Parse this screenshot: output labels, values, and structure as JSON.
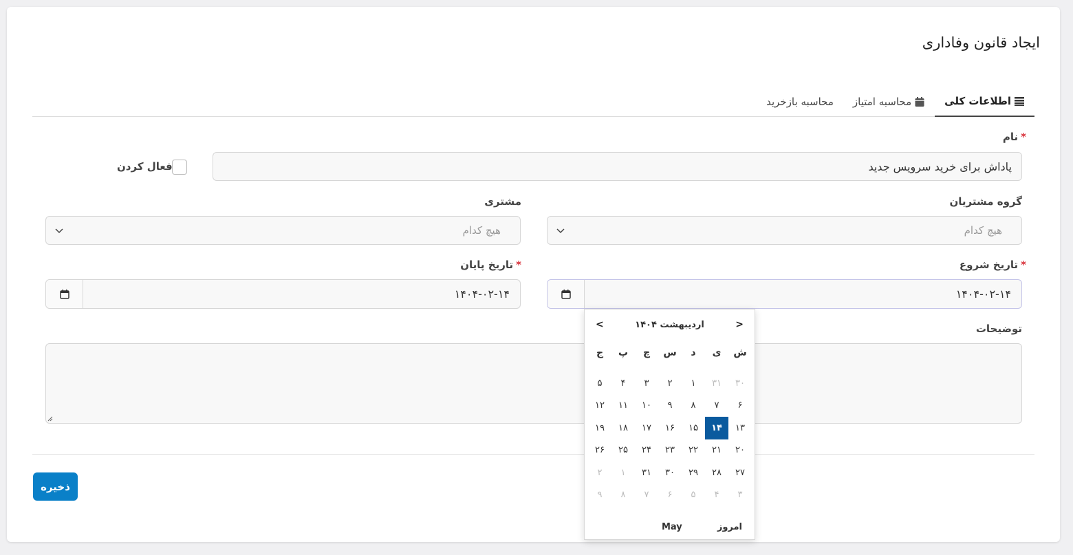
{
  "title": "ایجاد قانون وفاداری",
  "tabs": [
    {
      "label": "اطلاعات کلی",
      "icon": "list-icon",
      "active": true
    },
    {
      "label": "محاسبه امتیاز",
      "icon": "calendar-icon",
      "active": false
    },
    {
      "label": "محاسبه بازخرید",
      "icon": "",
      "active": false
    }
  ],
  "form": {
    "name_label": "نام",
    "name_value": "پاداش برای خرید سرویس جدید",
    "active_label": "فعال کردن",
    "customer_group_label": "گروه مشتریان",
    "customer_group_placeholder": "هیچ کدام",
    "customer_label": "مشتری",
    "customer_placeholder": "هیچ کدام",
    "start_date_label": "تاریخ شروع",
    "start_date_value": "۱۴۰۴-۰۲-۱۴",
    "end_date_label": "تاریخ پایان",
    "end_date_value": "۱۴۰۴-۰۲-۱۴",
    "description_label": "توضیحات",
    "required_mark": "*"
  },
  "save_label": "ذخیره",
  "calendar": {
    "month_title": "اردیبهشت ۱۴۰۴",
    "prev": "<",
    "next": ">",
    "weekdays": [
      "ش",
      "ی",
      "د",
      "س",
      "چ",
      "پ",
      "ج"
    ],
    "weeks": [
      [
        {
          "d": "۳۰",
          "o": true
        },
        {
          "d": "۳۱",
          "o": true
        },
        {
          "d": "۱"
        },
        {
          "d": "۲"
        },
        {
          "d": "۳"
        },
        {
          "d": "۴"
        },
        {
          "d": "۵"
        }
      ],
      [
        {
          "d": "۶"
        },
        {
          "d": "۷"
        },
        {
          "d": "۸"
        },
        {
          "d": "۹"
        },
        {
          "d": "۱۰"
        },
        {
          "d": "۱۱"
        },
        {
          "d": "۱۲"
        }
      ],
      [
        {
          "d": "۱۳"
        },
        {
          "d": "۱۴",
          "s": true
        },
        {
          "d": "۱۵"
        },
        {
          "d": "۱۶"
        },
        {
          "d": "۱۷"
        },
        {
          "d": "۱۸"
        },
        {
          "d": "۱۹"
        }
      ],
      [
        {
          "d": "۲۰"
        },
        {
          "d": "۲۱"
        },
        {
          "d": "۲۲"
        },
        {
          "d": "۲۳"
        },
        {
          "d": "۲۴"
        },
        {
          "d": "۲۵"
        },
        {
          "d": "۲۶"
        }
      ],
      [
        {
          "d": "۲۷"
        },
        {
          "d": "۲۸"
        },
        {
          "d": "۲۹"
        },
        {
          "d": "۳۰"
        },
        {
          "d": "۳۱"
        },
        {
          "d": "۱",
          "o": true
        },
        {
          "d": "۲",
          "o": true
        }
      ],
      [
        {
          "d": "۳",
          "o": true
        },
        {
          "d": "۴",
          "o": true
        },
        {
          "d": "۵",
          "o": true
        },
        {
          "d": "۶",
          "o": true
        },
        {
          "d": "۷",
          "o": true
        },
        {
          "d": "۸",
          "o": true
        },
        {
          "d": "۹",
          "o": true
        }
      ]
    ],
    "today_label": "امروز",
    "locale_label": "May"
  },
  "colors": {
    "accent": "#0a80c8",
    "selected_day": "#0a5a9e",
    "required": "#d9343d"
  }
}
